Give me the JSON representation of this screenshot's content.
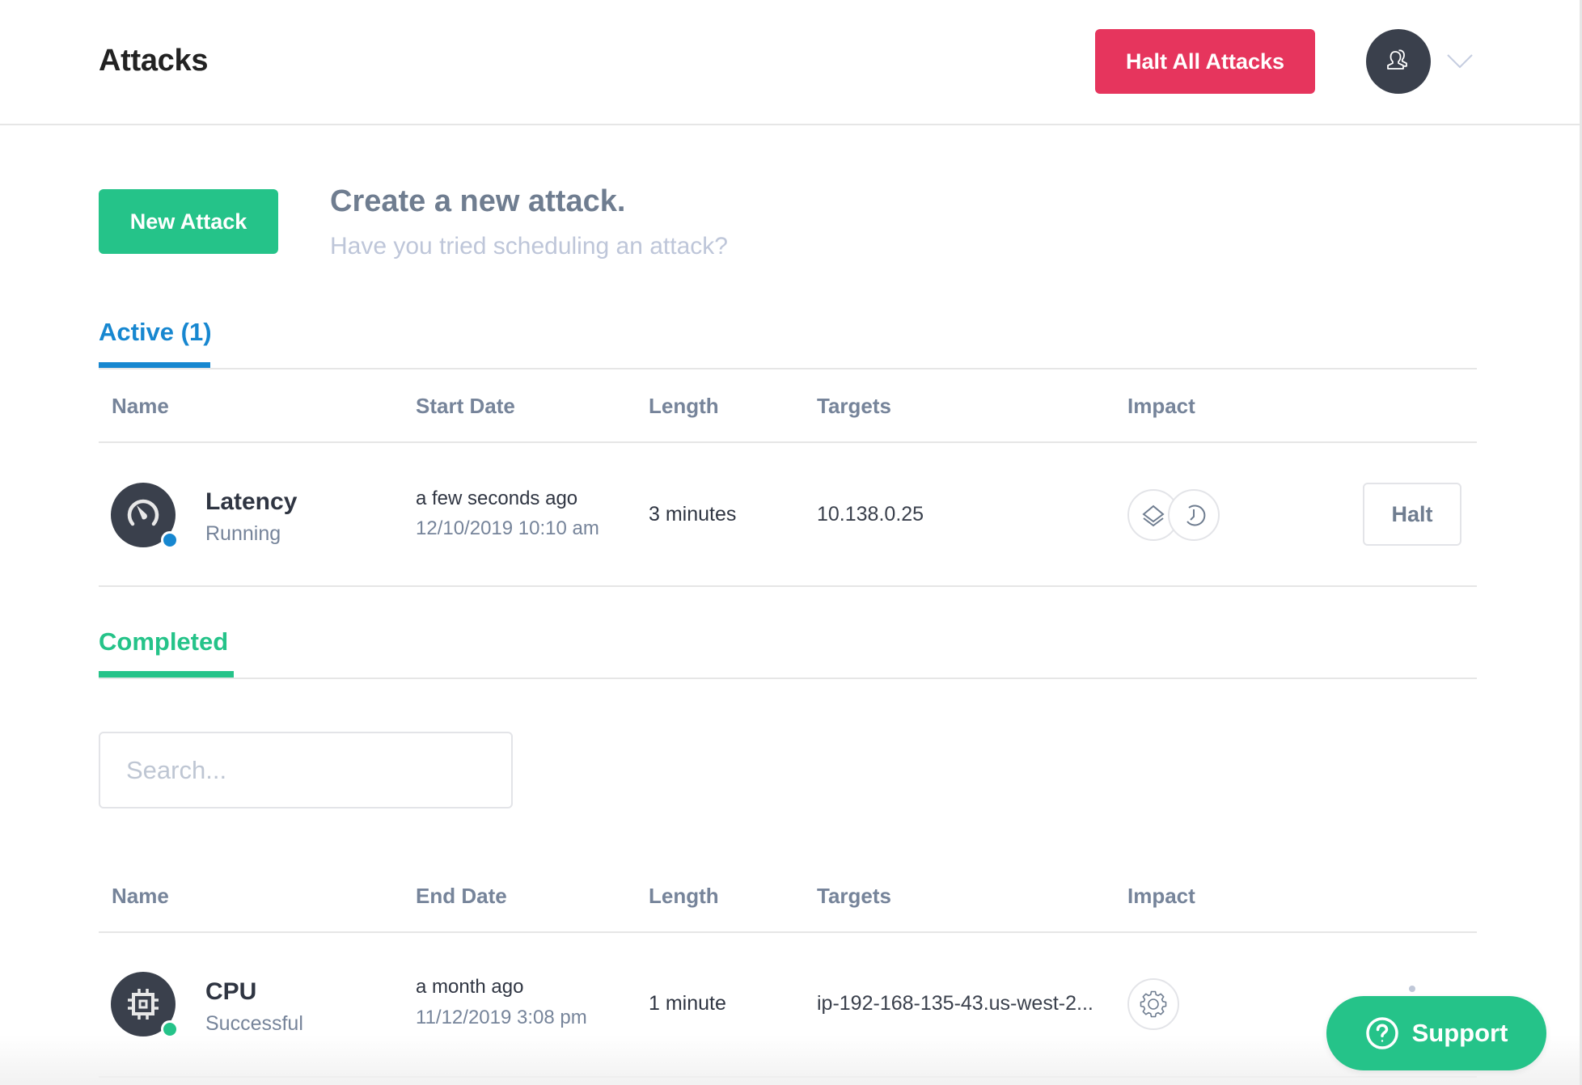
{
  "header": {
    "title": "Attacks",
    "halt_all_label": "Halt All Attacks",
    "avatar_icon": "user-icon",
    "menu_icon": "chevron-down-icon"
  },
  "create": {
    "button_label": "New Attack",
    "title": "Create a new attack.",
    "subtitle": "Have you tried scheduling an attack?"
  },
  "active": {
    "tab_label": "Active (1)",
    "columns": [
      "Name",
      "Start Date",
      "Length",
      "Targets",
      "Impact"
    ],
    "rows": [
      {
        "icon": "gauge-icon",
        "name": "Latency",
        "status": "Running",
        "date_relative": "a few seconds ago",
        "date_absolute": "12/10/2019 10:10 am",
        "length": "3 minutes",
        "targets": "10.138.0.25",
        "impact_icons": [
          "layers-icon",
          "clock-icon"
        ],
        "action_label": "Halt"
      }
    ]
  },
  "completed": {
    "tab_label": "Completed",
    "search_placeholder": "Search...",
    "search_value": "",
    "columns": [
      "Name",
      "End Date",
      "Length",
      "Targets",
      "Impact"
    ],
    "rows": [
      {
        "icon": "cpu-icon",
        "name": "CPU",
        "status": "Successful",
        "date_relative": "a month ago",
        "date_absolute": "11/12/2019 3:08 pm",
        "length": "1 minute",
        "targets": "ip-192-168-135-43.us-west-2...",
        "impact_icons": [
          "gear-icon"
        ]
      }
    ]
  },
  "support": {
    "label": "Support",
    "icon": "help-circle-icon"
  },
  "colors": {
    "danger": "#E6355D",
    "success": "#25C389",
    "primary": "#1787D0",
    "dark": "#3A404C",
    "muted": "#76849A"
  }
}
